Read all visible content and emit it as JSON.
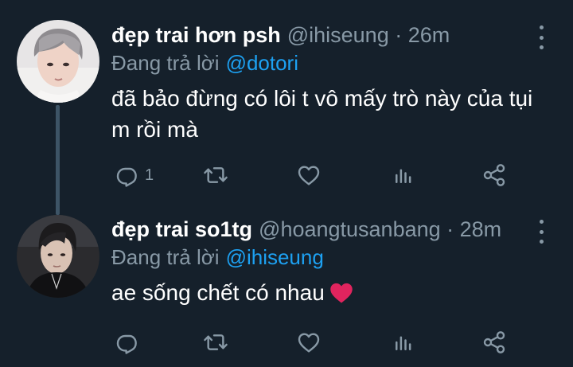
{
  "colors": {
    "background": "#15202b",
    "text_primary": "#ffffff",
    "text_secondary": "#8899a6",
    "accent_link": "#1da1f2",
    "thread_line": "#3d5466",
    "heart": "#e0245e"
  },
  "tweets": [
    {
      "display_name": "đẹp trai hơn psh",
      "handle_meta": "@ihiseung · 26m",
      "replying_label": "Đang trả lời",
      "replying_to": "@dotori",
      "text": "đã bảo đừng có lôi t vô mấy trò này của tụi m rồi mà",
      "emoji": "",
      "reply_count": "1",
      "icons": [
        "reply-icon",
        "retweet-icon",
        "like-icon",
        "analytics-icon",
        "share-icon",
        "more-icon"
      ]
    },
    {
      "display_name": "đẹp trai so1tg",
      "handle_meta": "@hoangtusanbang · 28m",
      "replying_label": "Đang trả lời",
      "replying_to": "@ihiseung",
      "text": "ae sống chết có nhau",
      "emoji": "red-heart",
      "reply_count": "",
      "icons": [
        "reply-icon",
        "retweet-icon",
        "like-icon",
        "analytics-icon",
        "share-icon",
        "more-icon"
      ]
    }
  ]
}
